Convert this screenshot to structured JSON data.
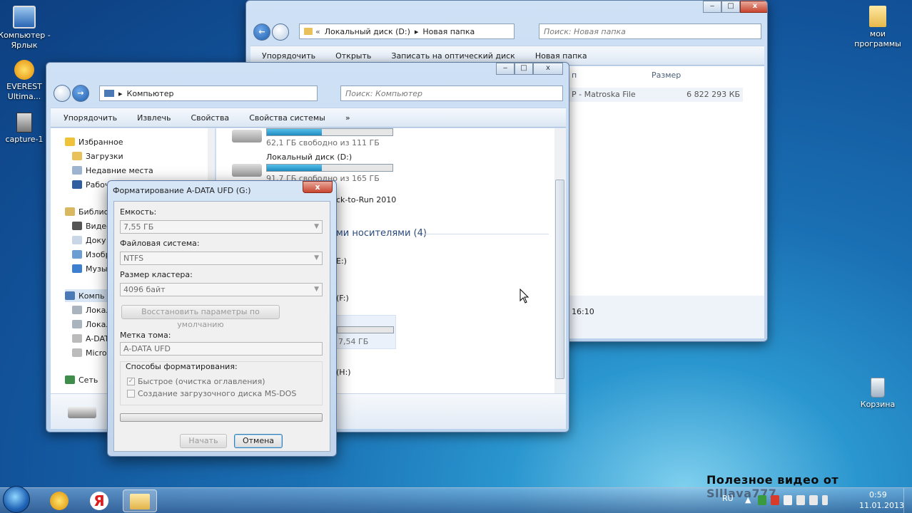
{
  "desktop": {
    "icons": [
      {
        "label": "Компьютер - Ярлык"
      },
      {
        "label": "EVEREST Ultima..."
      },
      {
        "label": "capture-1"
      },
      {
        "label": "мои программы"
      },
      {
        "label": "Корзина"
      }
    ],
    "watermark": "Полезное видео от Slllava777"
  },
  "back_window": {
    "address": [
      "Локальный диск (D:)",
      "Новая папка"
    ],
    "search_placeholder": "Поиск: Новая папка",
    "toolbar": [
      "Упорядочить",
      "Открыть",
      "Записать на оптический диск",
      "Новая папка"
    ],
    "column_size": "Размер",
    "column_name_partial": "п",
    "file_type": "P - Matroska File",
    "file_size": "6 822 293 КБ",
    "status_partial": "16:10"
  },
  "front_window": {
    "address": "Компьютер",
    "search_placeholder": "Поиск: Компьютер",
    "toolbar": [
      "Упорядочить",
      "Извлечь",
      "Свойства",
      "Свойства системы",
      "»"
    ],
    "nav": {
      "favorites": "Избранное",
      "downloads": "Загрузки",
      "recent": "Недавние места",
      "desktop": "Рабоч",
      "libraries": "Библио",
      "video": "Видео",
      "docs": "Доку",
      "images": "Изобр",
      "music": "Музы",
      "computer": "Компь",
      "local1": "Локал",
      "local2": "Локал",
      "adata": "A-DAT",
      "micro": "Micro",
      "network": "Сеть"
    },
    "drives": {
      "c_free": "62,1 ГБ свободно из 111 ГБ",
      "c_fill": 0.44,
      "d_name": "Локальный диск (D:)",
      "d_free": "91,7 ГБ свободно из 165 ГБ",
      "d_fill": 0.44,
      "ctr": "ck-to-Run 2010",
      "removable_group": "ми носителями (4)",
      "e": "E:)",
      "f": "(F:)",
      "g_free": "7,54 ГБ",
      "h": "(H:)"
    }
  },
  "dialog": {
    "title": "Форматирование A-DATA UFD (G:)",
    "close": "x",
    "capacity_label": "Емкость:",
    "capacity_value": "7,55 ГБ",
    "fs_label": "Файловая система:",
    "fs_value": "NTFS",
    "cluster_label": "Размер кластера:",
    "cluster_value": "4096 байт",
    "restore_button": "Восстановить параметры по умолчанию",
    "volume_label": "Метка тома:",
    "volume_value": "A-DATA UFD",
    "format_options_label": "Способы форматирования:",
    "quick_format": "Быстрое (очистка оглавления)",
    "msdos": "Создание загрузочного диска MS-DOS",
    "start_button": "Начать",
    "cancel_button": "Отмена"
  },
  "taskbar": {
    "lang": "RU",
    "time": "0:59",
    "date": "11.01.2013"
  }
}
